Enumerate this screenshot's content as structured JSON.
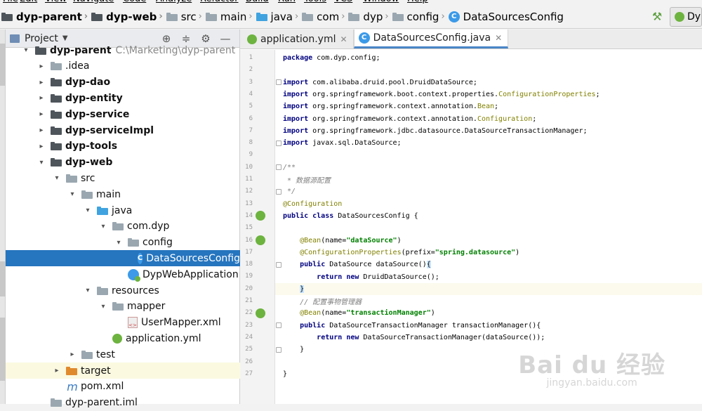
{
  "menu": [
    "File",
    "Edit",
    "View",
    "Navigate",
    "Code",
    "Analyze",
    "Refactor",
    "Build",
    "Run",
    "Tools",
    "VCS",
    "Window",
    "Help"
  ],
  "breadcrumbs": [
    {
      "label": "dyp-parent",
      "icon": "module",
      "bold": true
    },
    {
      "label": "dyp-web",
      "icon": "module",
      "bold": true
    },
    {
      "label": "src",
      "icon": "grey"
    },
    {
      "label": "main",
      "icon": "grey"
    },
    {
      "label": "java",
      "icon": "blue"
    },
    {
      "label": "com",
      "icon": "grey"
    },
    {
      "label": "dyp",
      "icon": "grey"
    },
    {
      "label": "config",
      "icon": "grey"
    },
    {
      "label": "DataSourcesConfig",
      "icon": "class"
    }
  ],
  "run_config": "Dyp",
  "project": {
    "title": "Project",
    "rows": [
      {
        "label": "dyp-parent",
        "path": "C:\\Marketing\\dyp-parent",
        "icon": "module",
        "arrow": "▾",
        "indent": 0,
        "bold": true
      },
      {
        "label": ".idea",
        "icon": "grey",
        "arrow": "▸",
        "indent": 1
      },
      {
        "label": "dyp-dao",
        "icon": "module",
        "arrow": "▸",
        "indent": 1,
        "bold": true
      },
      {
        "label": "dyp-entity",
        "icon": "module",
        "arrow": "▸",
        "indent": 1,
        "bold": true
      },
      {
        "label": "dyp-service",
        "icon": "module",
        "arrow": "▸",
        "indent": 1,
        "bold": true
      },
      {
        "label": "dyp-serviceImpl",
        "icon": "module",
        "arrow": "▸",
        "indent": 1,
        "bold": true
      },
      {
        "label": "dyp-tools",
        "icon": "module",
        "arrow": "▸",
        "indent": 1,
        "bold": true
      },
      {
        "label": "dyp-web",
        "icon": "module",
        "arrow": "▾",
        "indent": 1,
        "bold": true
      },
      {
        "label": "src",
        "icon": "grey",
        "arrow": "▾",
        "indent": 2
      },
      {
        "label": "main",
        "icon": "grey",
        "arrow": "▾",
        "indent": 3
      },
      {
        "label": "java",
        "icon": "blue",
        "arrow": "▾",
        "indent": 4
      },
      {
        "label": "com.dyp",
        "icon": "grey",
        "arrow": "▾",
        "indent": 5
      },
      {
        "label": "config",
        "icon": "grey",
        "arrow": "▾",
        "indent": 6
      },
      {
        "label": "DataSourcesConfig",
        "icon": "class",
        "arrow": "",
        "indent": 7,
        "selected": true
      },
      {
        "label": "DypWebApplication",
        "icon": "springclass",
        "arrow": "",
        "indent": 6
      },
      {
        "label": "resources",
        "icon": "res",
        "arrow": "▾",
        "indent": 4
      },
      {
        "label": "mapper",
        "icon": "grey",
        "arrow": "▾",
        "indent": 5
      },
      {
        "label": "UserMapper.xml",
        "icon": "xml",
        "arrow": "",
        "indent": 6
      },
      {
        "label": "application.yml",
        "icon": "yml",
        "arrow": "",
        "indent": 5
      },
      {
        "label": "test",
        "icon": "grey",
        "arrow": "▸",
        "indent": 3
      },
      {
        "label": "target",
        "icon": "orange",
        "arrow": "▸",
        "indent": 2,
        "highlight": true
      },
      {
        "label": "pom.xml",
        "icon": "maven",
        "arrow": "",
        "indent": 2
      },
      {
        "label": "dyp-parent.iml",
        "icon": "grey",
        "arrow": "",
        "indent": 1
      }
    ]
  },
  "tabs": [
    {
      "label": "application.yml",
      "icon": "yml",
      "active": false
    },
    {
      "label": "DataSourcesConfig.java",
      "icon": "class",
      "active": true
    }
  ],
  "code_lines": [
    {
      "n": "1",
      "html": "<span class='kw'>package</span> com.dyp.config;"
    },
    {
      "n": "2",
      "html": ""
    },
    {
      "n": "3",
      "html": "<span class='kw'>import</span> com.alibaba.druid.pool.DruidDataSource;",
      "fold": true
    },
    {
      "n": "4",
      "html": "<span class='kw'>import</span> org.springframework.boot.context.properties.<span class='cls'>ConfigurationProperties</span>;"
    },
    {
      "n": "5",
      "html": "<span class='kw'>import</span> org.springframework.context.annotation.<span class='cls'>Bean</span>;"
    },
    {
      "n": "6",
      "html": "<span class='kw'>import</span> org.springframework.context.annotation.<span class='cls'>Configuration</span>;"
    },
    {
      "n": "7",
      "html": "<span class='kw'>import</span> org.springframework.jdbc.datasource.DataSourceTransactionManager;"
    },
    {
      "n": "8",
      "html": "<span class='kw'>import</span> javax.sql.DataSource;",
      "fold": true
    },
    {
      "n": "9",
      "html": ""
    },
    {
      "n": "10",
      "html": "<span class='cmt'>/**</span>",
      "fold": true
    },
    {
      "n": "11",
      "html": "<span class='cmt'> * 数据源配置</span>"
    },
    {
      "n": "12",
      "html": "<span class='cmt'> */</span>",
      "fold": true
    },
    {
      "n": "13",
      "html": "<span class='anno'>@Configuration</span>"
    },
    {
      "n": "14",
      "html": "<span class='kw'>public class</span> DataSourcesConfig {",
      "gicon": true
    },
    {
      "n": "15",
      "html": ""
    },
    {
      "n": "16",
      "html": "    <span class='anno'>@Bean</span>(name=<span class='str'>\"dataSource\"</span>)",
      "gicon": true
    },
    {
      "n": "17",
      "html": "    <span class='anno'>@ConfigurationProperties</span>(prefix=<span class='str'>\"spring.datasource\"</span>)"
    },
    {
      "n": "18",
      "html": "    <span class='kw'>public</span> DataSource dataSource()<span class='brk'>{</span>",
      "fold": true
    },
    {
      "n": "19",
      "html": "        <span class='kw'>return new</span> DruidDataSource();"
    },
    {
      "n": "20",
      "html": "    <span class='brk'>}</span>",
      "fold": true,
      "caret": true
    },
    {
      "n": "21",
      "html": "    <span class='cmt'>// 配置事物管理器</span>"
    },
    {
      "n": "22",
      "html": "    <span class='anno'>@Bean</span>(name=<span class='str'>\"transactionManager\"</span>)",
      "gicon": true
    },
    {
      "n": "23",
      "html": "    <span class='kw'>public</span> DataSourceTransactionManager transactionManager(){",
      "fold": true
    },
    {
      "n": "24",
      "html": "        <span class='kw'>return new</span> DataSourceTransactionManager(dataSource());"
    },
    {
      "n": "25",
      "html": "    }",
      "fold": true
    },
    {
      "n": "26",
      "html": ""
    },
    {
      "n": "27",
      "html": "}"
    }
  ],
  "watermark": {
    "main": "Bai du 经验",
    "sub": "jingyan.baidu.com"
  }
}
